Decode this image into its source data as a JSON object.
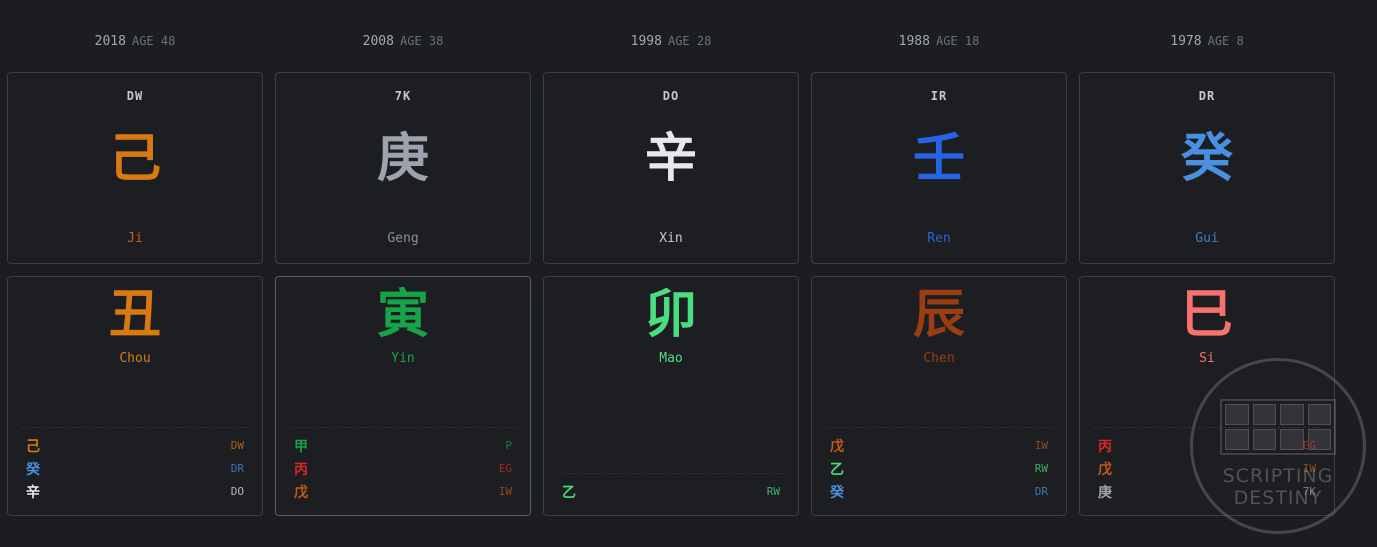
{
  "pillars": [
    {
      "year": "2018",
      "age": "AGE 48",
      "stem": {
        "god": "DW",
        "char": "己",
        "pinyin": "Ji",
        "color": "#d97a10",
        "pinyin_color": "#c0641a"
      },
      "branch": {
        "char": "丑",
        "pinyin": "Chou",
        "color": "#d97a10",
        "hidden": [
          {
            "char": "己",
            "god": "DW",
            "color": "#d97a10"
          },
          {
            "char": "癸",
            "god": "DR",
            "color": "#4a90e2"
          },
          {
            "char": "辛",
            "god": "DO",
            "color": "#e6e8eb"
          }
        ]
      }
    },
    {
      "year": "2008",
      "age": "AGE 38",
      "stem": {
        "god": "7K",
        "char": "庚",
        "pinyin": "Geng",
        "color": "#9ca3ad",
        "pinyin_color": "#8a9099"
      },
      "branch": {
        "char": "寅",
        "pinyin": "Yin",
        "color": "#16a34a",
        "hidden": [
          {
            "char": "甲",
            "god": "P",
            "color": "#16a34a"
          },
          {
            "char": "丙",
            "god": "EG",
            "color": "#dc2626"
          },
          {
            "char": "戊",
            "god": "IW",
            "color": "#c0581a"
          }
        ]
      }
    },
    {
      "year": "1998",
      "age": "AGE 28",
      "stem": {
        "god": "DO",
        "char": "辛",
        "pinyin": "Xin",
        "color": "#e6e8eb",
        "pinyin_color": "#c8cbd0"
      },
      "branch": {
        "char": "卯",
        "pinyin": "Mao",
        "color": "#4ade80",
        "hidden": [
          {
            "char": "乙",
            "god": "RW",
            "color": "#4ade80"
          }
        ]
      }
    },
    {
      "year": "1988",
      "age": "AGE 18",
      "stem": {
        "god": "IR",
        "char": "壬",
        "pinyin": "Ren",
        "color": "#2563eb",
        "pinyin_color": "#2f5fd0"
      },
      "branch": {
        "char": "辰",
        "pinyin": "Chen",
        "color": "#9a3d12",
        "hidden": [
          {
            "char": "戊",
            "god": "IW",
            "color": "#c0581a"
          },
          {
            "char": "乙",
            "god": "RW",
            "color": "#4ade80"
          },
          {
            "char": "癸",
            "god": "DR",
            "color": "#4a90e2"
          }
        ]
      }
    },
    {
      "year": "1978",
      "age": "AGE 8",
      "stem": {
        "god": "DR",
        "char": "癸",
        "pinyin": "Gui",
        "color": "#4a90e2",
        "pinyin_color": "#3f7cc8"
      },
      "branch": {
        "char": "巳",
        "pinyin": "Si",
        "color": "#f87171",
        "hidden": [
          {
            "char": "丙",
            "god": "EG",
            "color": "#dc2626"
          },
          {
            "char": "戊",
            "god": "IW",
            "color": "#c0581a"
          },
          {
            "char": "庚",
            "god": "7K",
            "color": "#9ca3ad"
          }
        ]
      }
    }
  ],
  "watermark": {
    "line1": "SCRIPTING",
    "line2": "DESTINY"
  }
}
